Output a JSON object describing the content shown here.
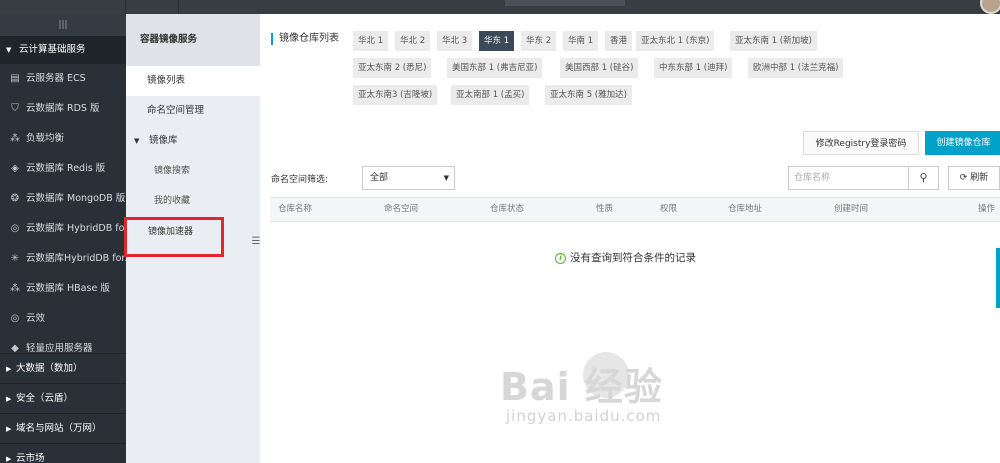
{
  "leftnav": {
    "collapse_icon": "|||",
    "group_main": "云计算基础服务",
    "items": [
      {
        "icon": "server-icon",
        "glyph": "▤",
        "label": "云服务器 ECS"
      },
      {
        "icon": "database-icon",
        "glyph": "⛉",
        "label": "云数据库 RDS 版"
      },
      {
        "icon": "balance-icon",
        "glyph": "⁂",
        "label": "负载均衡"
      },
      {
        "icon": "redis-icon",
        "glyph": "◈",
        "label": "云数据库 Redis 版"
      },
      {
        "icon": "mongodb-icon",
        "glyph": "❂",
        "label": "云数据库 MongoDB 版"
      },
      {
        "icon": "hybriddb-icon",
        "glyph": "◎",
        "label": "云数据库 HybridDB fo..."
      },
      {
        "icon": "hybriddb2-icon",
        "glyph": "✳",
        "label": "云数据库HybridDB for..."
      },
      {
        "icon": "hbase-icon",
        "glyph": "⁂",
        "label": "云数据库 HBase 版"
      },
      {
        "icon": "yunxiao-icon",
        "glyph": "◎",
        "label": "云效"
      },
      {
        "icon": "app-server-icon",
        "glyph": "◆",
        "label": "轻量应用服务器"
      }
    ],
    "bottom_groups": [
      "大数据（数加）",
      "安全（云盾）",
      "域名与网站（万网）",
      "云市场"
    ]
  },
  "subnav": {
    "title": "容器镜像服务",
    "links": [
      "镜像列表",
      "命名空间管理"
    ],
    "folder": "镜像库",
    "sublinks": [
      "镜像搜索",
      "我的收藏"
    ],
    "highlighted": "镜像加速器"
  },
  "main": {
    "regions_label": "镜像仓库列表",
    "regions": [
      "华北 1",
      "华北 2",
      "华北 3",
      "华东 1",
      "华东 2",
      "华南 1",
      "香港",
      "亚太东北 1 (东京)",
      "亚太东南 1 (新加坡)",
      "亚太东南 2 (悉尼)",
      "美国东部 1 (弗吉尼亚)",
      "美国西部 1 (硅谷)",
      "中东东部 1 (迪拜)",
      "欧洲中部 1 (法兰克福)",
      "亚太东南3 (吉隆坡)",
      "亚太南部 1 (孟买)",
      "亚太东南 5 (雅加达)"
    ],
    "active_region": "华东 1",
    "edit_button": "修改Registry登录密码",
    "create_button": "创建镜像仓库",
    "filter_label": "命名空间筛选:",
    "filter_value": "全部",
    "search_placeholder": "仓库名称",
    "refresh_label": "刷新",
    "columns": [
      "仓库名称",
      "命名空间",
      "仓库状态",
      "性质",
      "权限",
      "仓库地址",
      "创建时间",
      "操作"
    ],
    "empty_text": "没有查询到符合条件的记录"
  },
  "watermark": {
    "brand": "Bai  经验",
    "url": "jingyan.baidu.com"
  },
  "colors": {
    "accent": "#00a2ca",
    "nav_bg": "#293038",
    "highlight_border": "#e3262b",
    "active_region_bg": "#3b4a59"
  }
}
